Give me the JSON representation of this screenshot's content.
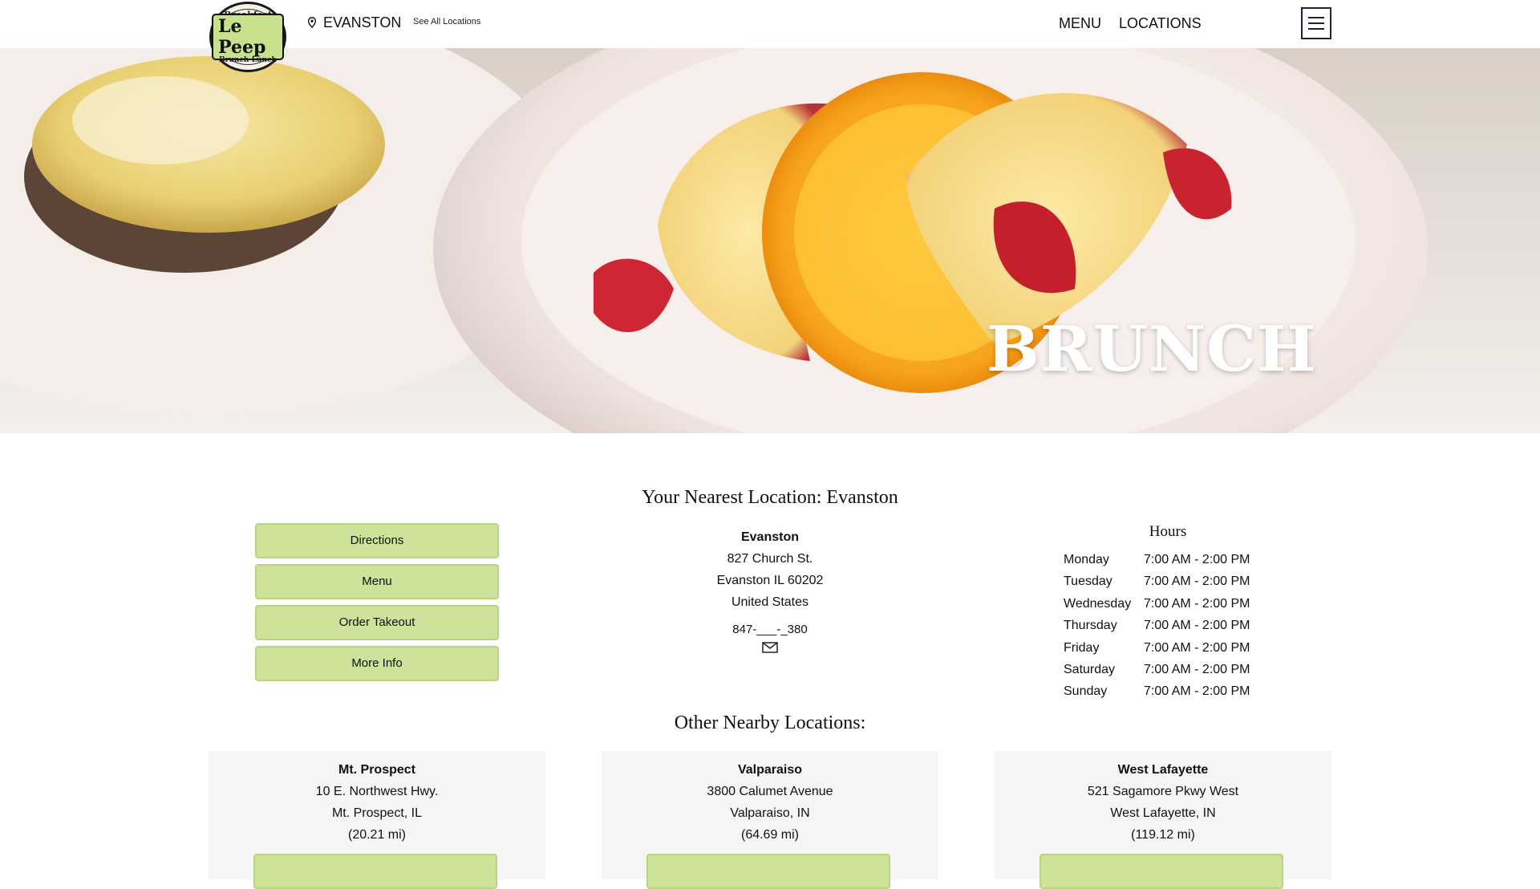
{
  "header": {
    "logo": {
      "brand": "Le Peep",
      "top_word": "Breakfast",
      "bottom_word": "Brunch·Lunch"
    },
    "current_location": "EVANSTON",
    "see_all": "See All Locations",
    "nav": {
      "menu": "MENU",
      "locations": "LOCATIONS"
    },
    "icons": {
      "location": "map-pin-icon",
      "hamburger": "hamburger-menu-icon"
    }
  },
  "hero": {
    "title": "BRUNCH"
  },
  "nearest": {
    "title": "Your Nearest Location: Evanston",
    "buttons": [
      "Directions",
      "Menu",
      "Order Takeout",
      "More Info"
    ],
    "address": {
      "name": "Evanston",
      "street": "827 Church St.",
      "city": "Evanston IL 60202",
      "country": "United States",
      "phone": "847-___-_380"
    },
    "hours": {
      "title": "Hours",
      "rows": [
        {
          "day": "Monday",
          "time": "7:00 AM - 2:00 PM"
        },
        {
          "day": "Tuesday",
          "time": "7:00 AM - 2:00 PM"
        },
        {
          "day": "Wednesday",
          "time": "7:00 AM - 2:00 PM"
        },
        {
          "day": "Thursday",
          "time": "7:00 AM - 2:00 PM"
        },
        {
          "day": "Friday",
          "time": "7:00 AM - 2:00 PM"
        },
        {
          "day": "Saturday",
          "time": "7:00 AM - 2:00 PM"
        },
        {
          "day": "Sunday",
          "time": "7:00 AM - 2:00 PM"
        }
      ]
    }
  },
  "other": {
    "title": "Other Nearby Locations:",
    "cards": [
      {
        "name": "Mt. Prospect",
        "street": "10 E. Northwest Hwy.",
        "city": "Mt. Prospect, IL",
        "distance": "(20.21 mi)"
      },
      {
        "name": "Valparaiso",
        "street": "3800 Calumet Avenue",
        "city": "Valparaiso, IN",
        "distance": "(64.69 mi)"
      },
      {
        "name": "West Lafayette",
        "street": "521 Sagamore Pkwy West",
        "city": "West Lafayette, IN",
        "distance": "(119.12 mi)"
      }
    ]
  },
  "colors": {
    "accent_green": "#cde39a",
    "card_bg": "#f5f5f5",
    "hero_title": "#ffffff"
  }
}
